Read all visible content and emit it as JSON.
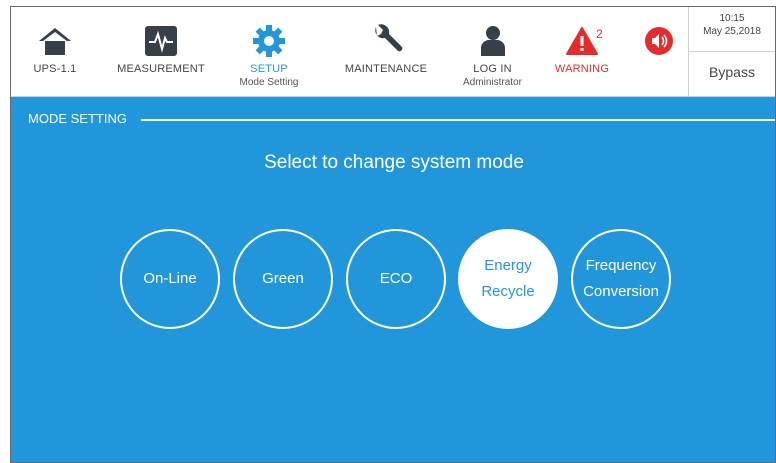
{
  "nav": {
    "ups": {
      "label": "UPS-1.1",
      "icon": "home-icon"
    },
    "measurement": {
      "label": "MEASUREMENT",
      "icon": "pulse-icon"
    },
    "setup": {
      "label": "SETUP",
      "sub": "Mode Setting",
      "icon": "gear-icon"
    },
    "maintenance": {
      "label": "MAINTENANCE",
      "icon": "wrench-icon"
    },
    "login": {
      "label": "LOG IN",
      "sub": "Administrator",
      "icon": "user-icon"
    },
    "warning": {
      "label": "WARNING",
      "count": "2",
      "icon": "warning-icon"
    },
    "sound": {
      "icon": "speaker-icon"
    }
  },
  "status": {
    "time": "10:15",
    "date": "May 25,2018",
    "mode": "Bypass"
  },
  "section": {
    "title": "MODE SETTING"
  },
  "headline": "Select to change system mode",
  "modes": [
    {
      "label": "On-Line"
    },
    {
      "label": "Green"
    },
    {
      "label": "ECO"
    },
    {
      "label": "Energy\nRecycle",
      "selected": true
    },
    {
      "label": "Frequency\nConversion"
    }
  ],
  "colors": {
    "accent": "#2296da",
    "warning": "#e52b2b",
    "icon": "#36404a"
  }
}
